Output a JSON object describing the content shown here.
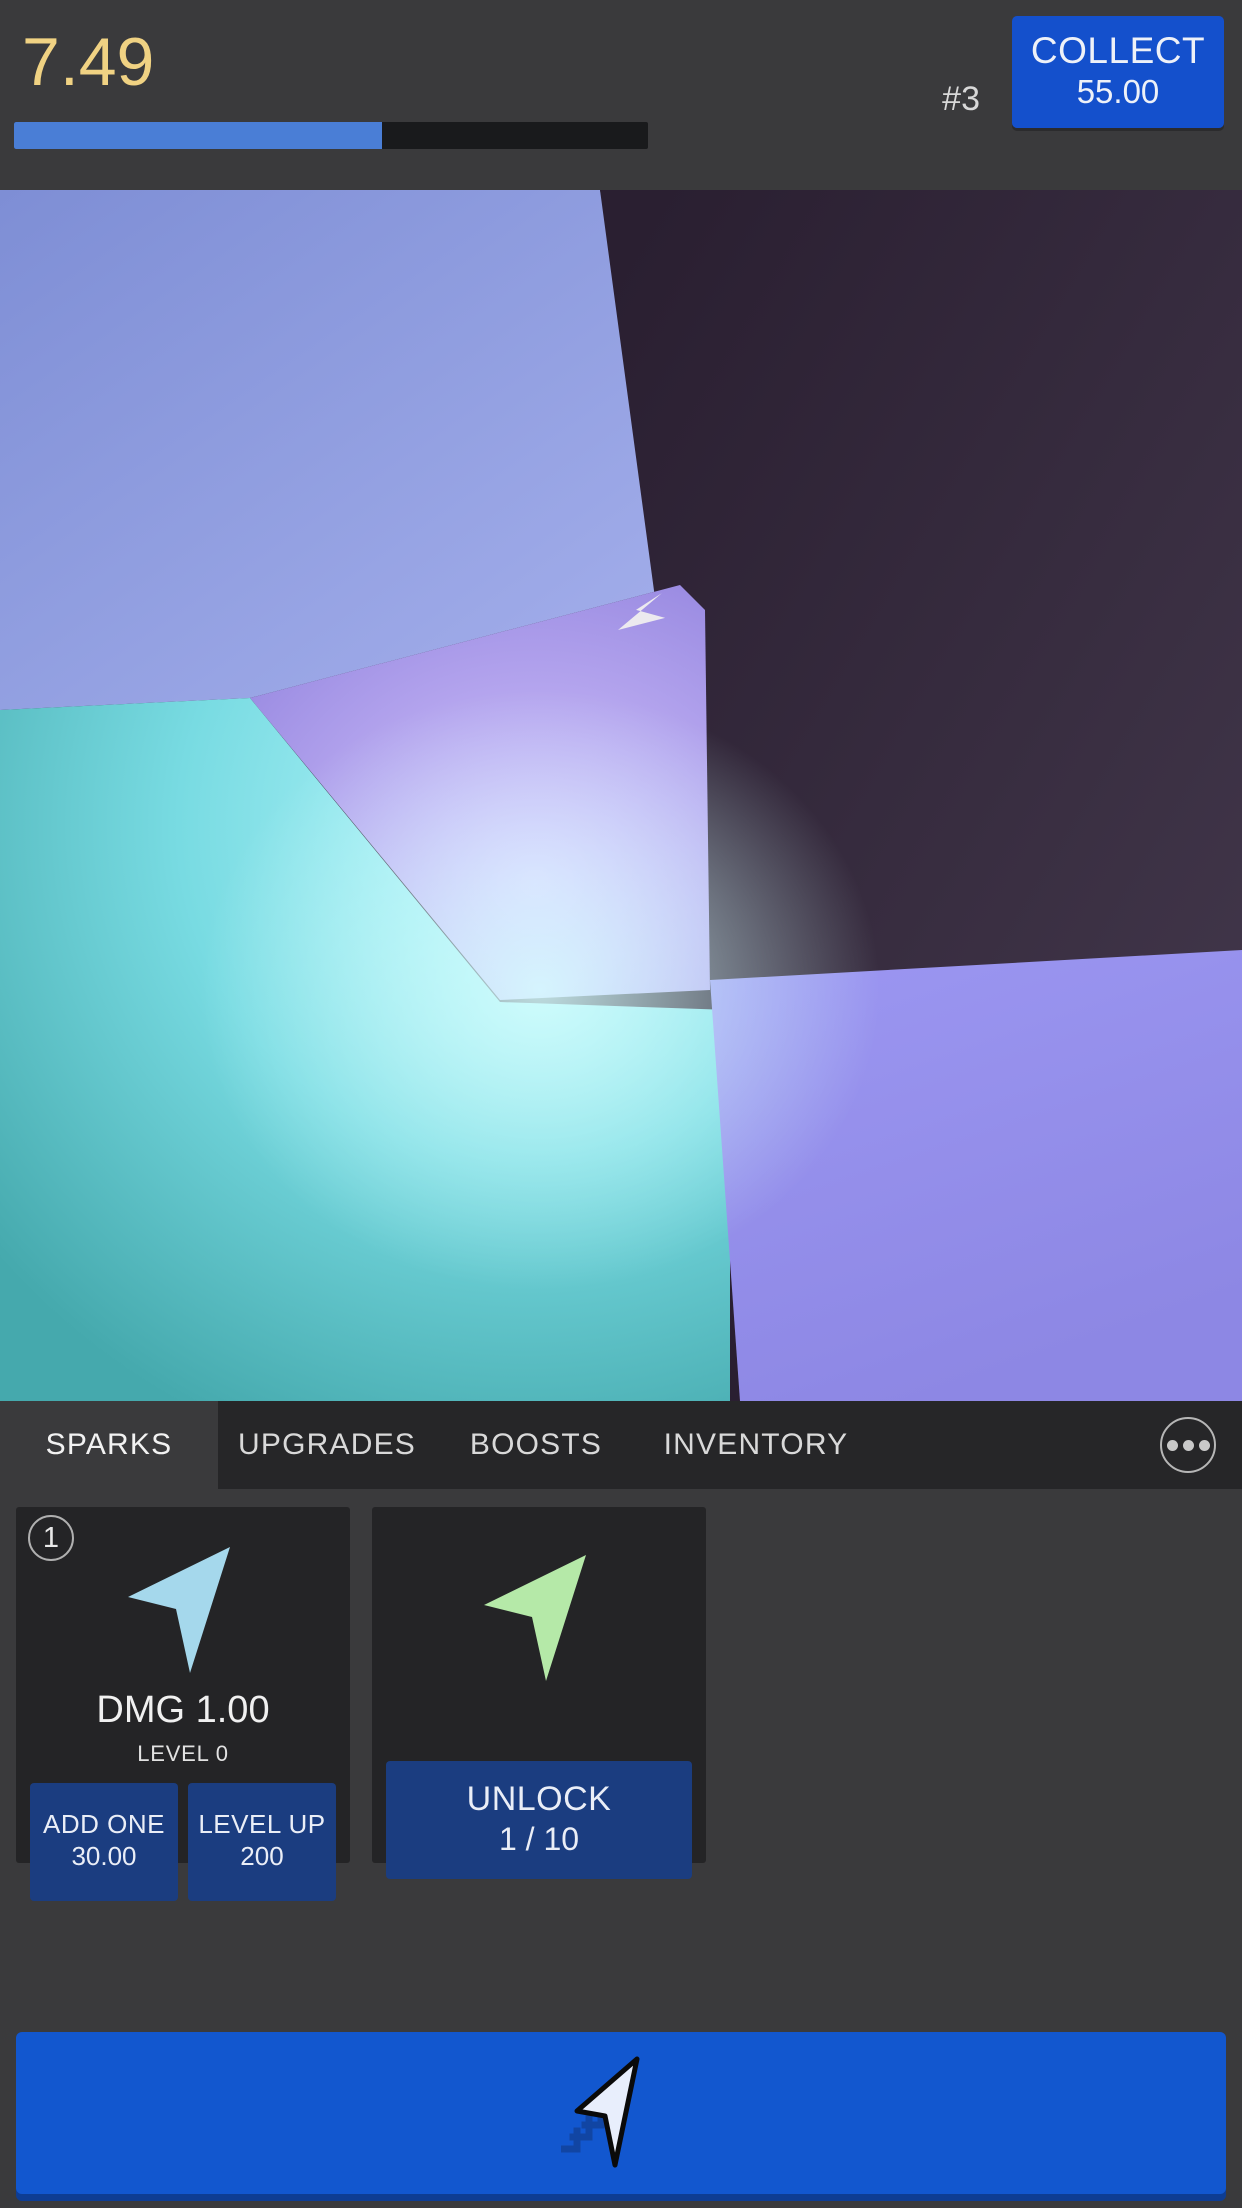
{
  "hud": {
    "score": "7.49",
    "rank": "#3",
    "collect_label": "COLLECT",
    "collect_amount": "55.00",
    "progress_percent": 58,
    "progress_fill_color": "#4a7ed6",
    "progress_track_color": "#191a1c",
    "score_color": "#f0d283",
    "accent_color": "#1450cc"
  },
  "canvas": {
    "cursor_icon": "arrow-cursor-icon",
    "polygons": [
      {
        "name": "shard-top-left",
        "color_from": "#7f8fd6",
        "color_to": "#9aa6e6"
      },
      {
        "name": "shard-top-right",
        "color_from": "#2e2235",
        "color_to": "#3d3246"
      },
      {
        "name": "shard-center",
        "color_from": "#a391e8",
        "color_to": "#cbb8f5"
      },
      {
        "name": "shard-bottom-left",
        "color_from": "#4fb3b3",
        "color_to": "#9ff0f6"
      },
      {
        "name": "shard-bottom-right",
        "color_from": "#8f8ae8",
        "color_to": "#a9a3f2"
      }
    ]
  },
  "tabs": [
    {
      "id": "sparks",
      "label": "SPARKS",
      "active": true
    },
    {
      "id": "upgrades",
      "label": "UPGRADES",
      "active": false
    },
    {
      "id": "boosts",
      "label": "BOOSTS",
      "active": false
    },
    {
      "id": "inventory",
      "label": "INVENTORY",
      "active": false
    }
  ],
  "more_menu": {
    "icon": "ellipsis-icon"
  },
  "cards": [
    {
      "badge": "1",
      "arrow_color": "#a5d8ec",
      "arrow_icon": "arrow-cursor-icon",
      "title": "DMG 1.00",
      "subtitle": "LEVEL 0",
      "buttons": [
        {
          "id": "add-one",
          "label": "ADD ONE",
          "cost": "30.00"
        },
        {
          "id": "level-up",
          "label": "LEVEL UP",
          "cost": "200"
        }
      ]
    },
    {
      "badge": "",
      "arrow_color": "#b5e9a8",
      "arrow_icon": "arrow-cursor-icon",
      "title": "",
      "subtitle": "",
      "buttons": [
        {
          "id": "unlock",
          "label": "UNLOCK",
          "cost": "1 / 10"
        }
      ]
    }
  ],
  "tap_button": {
    "icon": "click-cursor-icon",
    "color": "#1257cf",
    "shadow_color": "#0e3d93"
  }
}
